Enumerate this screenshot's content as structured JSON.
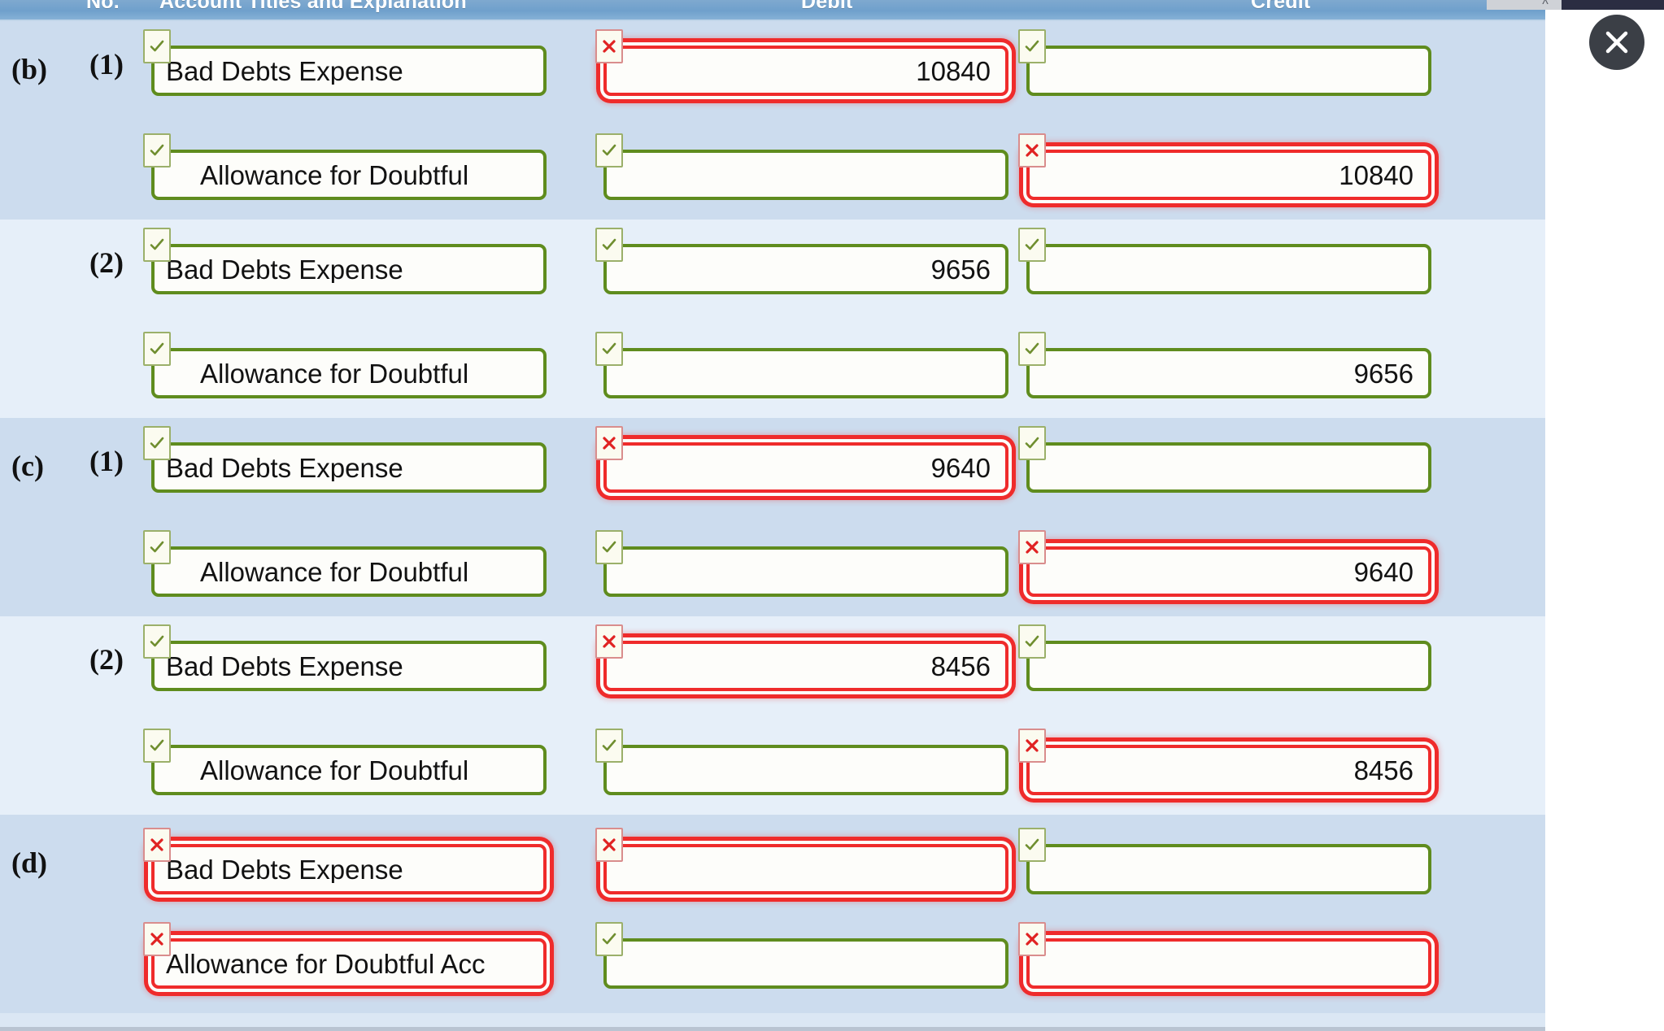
{
  "header": {
    "col_no": "No.",
    "col_titles": "Account Titles and Explanation",
    "col_debit": "Debit",
    "col_credit": "Credit"
  },
  "close_button": {
    "label": "Close",
    "icon": "close-icon"
  },
  "markers": {
    "correct_icon": "check-icon",
    "incorrect_icon": "cross-icon",
    "correct_color": "#5f8c1e",
    "incorrect_color": "#ef2b2b"
  },
  "rows": [
    {
      "outer_label": "(b)",
      "inner_label": "(1)",
      "shade": "dark",
      "title": {
        "value": "Bad Debts Expense",
        "status": "correct",
        "align": "left"
      },
      "debit": {
        "value": "10840",
        "status": "incorrect",
        "align": "right"
      },
      "credit": {
        "value": "",
        "status": "correct",
        "align": "right"
      }
    },
    {
      "outer_label": "",
      "inner_label": "",
      "shade": "dark",
      "title": {
        "value": "Allowance for Doubtful",
        "status": "correct",
        "align": "indent"
      },
      "debit": {
        "value": "",
        "status": "correct",
        "align": "right"
      },
      "credit": {
        "value": "10840",
        "status": "incorrect",
        "align": "right"
      }
    },
    {
      "outer_label": "",
      "inner_label": "(2)",
      "shade": "light",
      "title": {
        "value": "Bad Debts Expense",
        "status": "correct",
        "align": "left"
      },
      "debit": {
        "value": "9656",
        "status": "correct",
        "align": "right"
      },
      "credit": {
        "value": "",
        "status": "correct",
        "align": "right"
      }
    },
    {
      "outer_label": "",
      "inner_label": "",
      "shade": "light",
      "title": {
        "value": "Allowance for Doubtful",
        "status": "correct",
        "align": "indent"
      },
      "debit": {
        "value": "",
        "status": "correct",
        "align": "right"
      },
      "credit": {
        "value": "9656",
        "status": "correct",
        "align": "right"
      }
    },
    {
      "outer_label": "(c)",
      "inner_label": "(1)",
      "shade": "dark",
      "title": {
        "value": "Bad Debts Expense",
        "status": "correct",
        "align": "left"
      },
      "debit": {
        "value": "9640",
        "status": "incorrect",
        "align": "right"
      },
      "credit": {
        "value": "",
        "status": "correct",
        "align": "right"
      }
    },
    {
      "outer_label": "",
      "inner_label": "",
      "shade": "dark",
      "title": {
        "value": "Allowance for Doubtful",
        "status": "correct",
        "align": "indent"
      },
      "debit": {
        "value": "",
        "status": "correct",
        "align": "right"
      },
      "credit": {
        "value": "9640",
        "status": "incorrect",
        "align": "right"
      }
    },
    {
      "outer_label": "",
      "inner_label": "(2)",
      "shade": "light",
      "title": {
        "value": "Bad Debts Expense",
        "status": "correct",
        "align": "left"
      },
      "debit": {
        "value": "8456",
        "status": "incorrect",
        "align": "right"
      },
      "credit": {
        "value": "",
        "status": "correct",
        "align": "right"
      }
    },
    {
      "outer_label": "",
      "inner_label": "",
      "shade": "light",
      "title": {
        "value": "Allowance for Doubtful",
        "status": "correct",
        "align": "indent"
      },
      "debit": {
        "value": "",
        "status": "correct",
        "align": "right"
      },
      "credit": {
        "value": "8456",
        "status": "incorrect",
        "align": "right"
      }
    },
    {
      "outer_label": "(d)",
      "inner_label": "",
      "shade": "dark",
      "title": {
        "value": "Bad Debts Expense",
        "status": "incorrect",
        "align": "left"
      },
      "debit": {
        "value": "",
        "status": "incorrect",
        "align": "right"
      },
      "credit": {
        "value": "",
        "status": "correct",
        "align": "right"
      }
    },
    {
      "outer_label": "",
      "inner_label": "",
      "shade": "dark",
      "title": {
        "value": "Allowance for Doubtful Acc",
        "status": "incorrect",
        "align": "left"
      },
      "debit": {
        "value": "",
        "status": "correct",
        "align": "right"
      },
      "credit": {
        "value": "",
        "status": "incorrect",
        "align": "right"
      }
    }
  ]
}
